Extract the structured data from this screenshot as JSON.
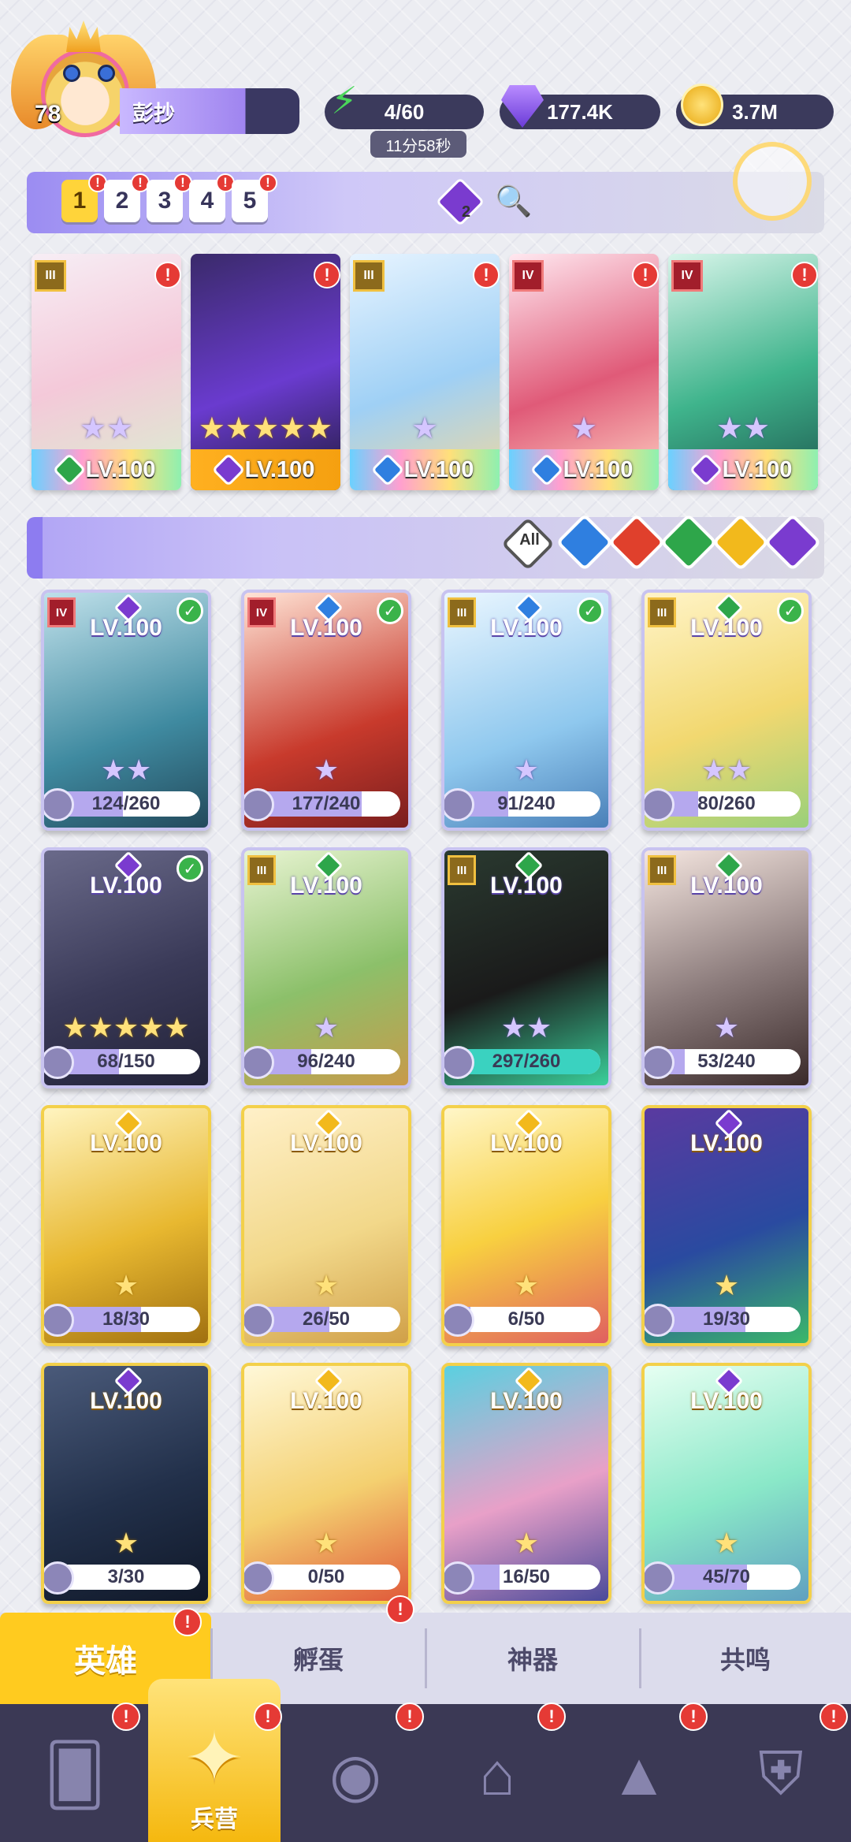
{
  "player": {
    "level": "78",
    "name": "彭抄"
  },
  "resources": {
    "energy": "4/60",
    "energy_timer": "11分58秒",
    "gems": "177.4K",
    "coins": "3.7M"
  },
  "team_tabs": [
    "1",
    "2",
    "3",
    "4",
    "5"
  ],
  "filter_count": "2",
  "team_cards": [
    {
      "level": "LV.100",
      "rank": "III",
      "stars": "★★",
      "element": "wind"
    },
    {
      "level": "LV.100",
      "rank": "",
      "stars": "★★★★★",
      "element": "dark"
    },
    {
      "level": "LV.100",
      "rank": "III",
      "stars": "★",
      "element": "water"
    },
    {
      "level": "LV.100",
      "rank": "IV",
      "stars": "★",
      "element": "water"
    },
    {
      "level": "LV.100",
      "rank": "IV",
      "stars": "★★",
      "element": "dark"
    }
  ],
  "filters": {
    "all_label": "All",
    "elements": [
      "water",
      "fire",
      "wind",
      "light",
      "dark"
    ]
  },
  "hero_grid": [
    {
      "level": "LV.100",
      "rank": "IV",
      "stars": "★★",
      "progress": "124/260",
      "fill": 0.48,
      "element": "dark",
      "owned": true,
      "gold": false
    },
    {
      "level": "LV.100",
      "rank": "IV",
      "stars": "★",
      "progress": "177/240",
      "fill": 0.74,
      "element": "water",
      "owned": true,
      "gold": false
    },
    {
      "level": "LV.100",
      "rank": "III",
      "stars": "★",
      "progress": "91/240",
      "fill": 0.38,
      "element": "water",
      "owned": true,
      "gold": false
    },
    {
      "level": "LV.100",
      "rank": "III",
      "stars": "★★",
      "progress": "80/260",
      "fill": 0.31,
      "element": "wind",
      "owned": true,
      "gold": false
    },
    {
      "level": "LV.100",
      "rank": "",
      "stars": "★★★★★",
      "progress": "68/150",
      "fill": 0.45,
      "element": "dark",
      "owned": true,
      "gold": false
    },
    {
      "level": "LV.100",
      "rank": "III",
      "stars": "★",
      "progress": "96/240",
      "fill": 0.4,
      "element": "wind",
      "owned": false,
      "gold": false
    },
    {
      "level": "LV.100",
      "rank": "III",
      "stars": "★★",
      "progress": "297/260",
      "fill": 1.0,
      "element": "wind",
      "owned": false,
      "gold": false
    },
    {
      "level": "LV.100",
      "rank": "III",
      "stars": "★",
      "progress": "53/240",
      "fill": 0.22,
      "element": "wind",
      "owned": false,
      "gold": false
    },
    {
      "level": "LV.100",
      "rank": "",
      "stars": "★",
      "progress": "18/30",
      "fill": 0.6,
      "element": "light",
      "owned": false,
      "gold": true
    },
    {
      "level": "LV.100",
      "rank": "",
      "stars": "★",
      "progress": "26/50",
      "fill": 0.52,
      "element": "light",
      "owned": false,
      "gold": true
    },
    {
      "level": "LV.100",
      "rank": "",
      "stars": "★",
      "progress": "6/50",
      "fill": 0.12,
      "element": "light",
      "owned": false,
      "gold": true
    },
    {
      "level": "LV.100",
      "rank": "",
      "stars": "★",
      "progress": "19/30",
      "fill": 0.63,
      "element": "dark",
      "owned": false,
      "gold": true
    },
    {
      "level": "LV.100",
      "rank": "",
      "stars": "★",
      "progress": "3/30",
      "fill": 0.1,
      "element": "dark",
      "owned": false,
      "gold": true
    },
    {
      "level": "LV.100",
      "rank": "",
      "stars": "★",
      "progress": "0/50",
      "fill": 0.0,
      "element": "light",
      "owned": false,
      "gold": true
    },
    {
      "level": "LV.100",
      "rank": "",
      "stars": "★",
      "progress": "16/50",
      "fill": 0.32,
      "element": "light",
      "owned": false,
      "gold": true
    },
    {
      "level": "LV.100",
      "rank": "",
      "stars": "★",
      "progress": "45/70",
      "fill": 0.64,
      "element": "dark",
      "owned": false,
      "gold": true
    }
  ],
  "sub_tabs": [
    "英雄",
    "孵蛋",
    "神器",
    "共鸣"
  ],
  "nav": {
    "barracks_label": "兵营"
  },
  "colors": {
    "water": "#2f7fe0",
    "fire": "#e0402c",
    "wind": "#2ea64a",
    "light": "#f2b91c",
    "dark": "#7a3bcf",
    "accent": "#ffcb1f",
    "alert": "#e53a35"
  }
}
